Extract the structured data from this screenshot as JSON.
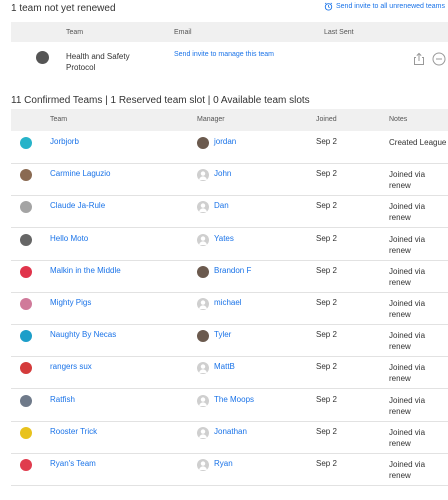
{
  "unrenewed": {
    "title": "1 team not yet renewed",
    "send_all": "Send invite to all unrenewed teams",
    "headers": {
      "team": "Team",
      "email": "Email",
      "last_sent": "Last Sent"
    },
    "rows": [
      {
        "team": "Health and Safety Protocol",
        "email": "Send invite to manage this team",
        "last_sent": ""
      }
    ]
  },
  "confirmed": {
    "title": "11 Confirmed Teams | 1 Reserved team slot | 0 Available team slots",
    "headers": {
      "team": "Team",
      "manager": "Manager",
      "joined": "Joined",
      "notes": "Notes"
    },
    "rows": [
      {
        "team": "Jorbjorb",
        "manager": "jordan",
        "joined": "Sep 2",
        "notes": "Created League",
        "icon_color": "#27b3c9",
        "avatar": "photo"
      },
      {
        "team": "Carmine Laguzio",
        "manager": "John",
        "joined": "Sep 2",
        "notes": "Joined via renew",
        "icon_color": "#8a6a52",
        "avatar": "default"
      },
      {
        "team": "Claude Ja-Rule",
        "manager": "Dan",
        "joined": "Sep 2",
        "notes": "Joined via renew",
        "icon_color": "#a4a4a4",
        "avatar": "default"
      },
      {
        "team": "Hello Moto",
        "manager": "Yates",
        "joined": "Sep 2",
        "notes": "Joined via renew",
        "icon_color": "#666666",
        "avatar": "default"
      },
      {
        "team": "Malkin in the Middle",
        "manager": "Brandon F",
        "joined": "Sep 2",
        "notes": "Joined via renew",
        "icon_color": "#e0344b",
        "avatar": "photo"
      },
      {
        "team": "Mighty Pigs",
        "manager": "michael",
        "joined": "Sep 2",
        "notes": "Joined via renew",
        "icon_color": "#d07a9a",
        "avatar": "default"
      },
      {
        "team": "Naughty By Necas",
        "manager": "Tyler",
        "joined": "Sep 2",
        "notes": "Joined via renew",
        "icon_color": "#1d9ec9",
        "avatar": "photo"
      },
      {
        "team": "rangers sux",
        "manager": "MattB",
        "joined": "Sep 2",
        "notes": "Joined via renew",
        "icon_color": "#d43b3b",
        "avatar": "default"
      },
      {
        "team": "Ratfish",
        "manager": "The Moops",
        "joined": "Sep 2",
        "notes": "Joined via renew",
        "icon_color": "#6f7a8a",
        "avatar": "default"
      },
      {
        "team": "Rooster Trick",
        "manager": "Jonathan",
        "joined": "Sep 2",
        "notes": "Joined via renew",
        "icon_color": "#e8c21d",
        "avatar": "default"
      },
      {
        "team": "Ryan's Team",
        "manager": "Ryan",
        "joined": "Sep 2",
        "notes": "Joined via renew",
        "icon_color": "#e03c4e",
        "avatar": "default"
      }
    ]
  }
}
